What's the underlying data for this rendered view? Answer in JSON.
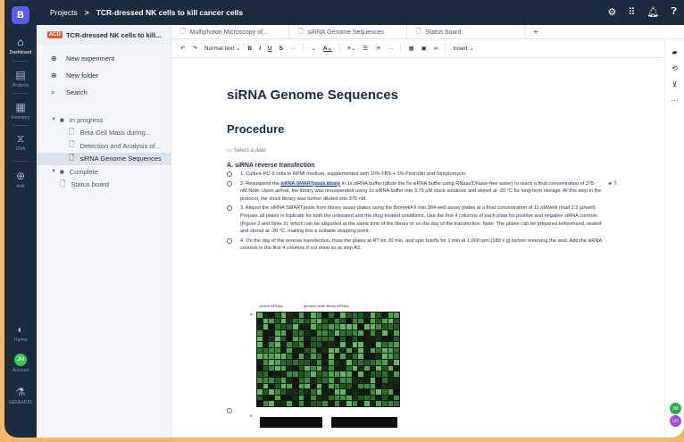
{
  "app": {
    "logo": "B"
  },
  "nav_rail": {
    "items": [
      {
        "label": "Dashboard",
        "icon": "home-icon"
      },
      {
        "label": "Projects",
        "icon": "clipboard-icon"
      },
      {
        "label": "Inventory",
        "icon": "box-icon"
      },
      {
        "label": "DNA",
        "icon": "dna-icon"
      },
      {
        "label": "Add",
        "icon": "plus-circle-icon"
      }
    ],
    "bottom": [
      {
        "label": "Theme",
        "icon": "half-circle-icon"
      },
      {
        "label": "Account",
        "avatar": "JM"
      },
      {
        "label": "GENEMOD",
        "icon": "flask-icon"
      }
    ]
  },
  "topbar": {
    "crumb1": "Projects",
    "separator": ">",
    "crumb2": "TCR-dressed NK cells to kill cancer cells",
    "tools": [
      "gear-icon",
      "grid-icon",
      "bell-icon",
      "help-icon"
    ]
  },
  "sidebar": {
    "tag": "ACD",
    "title": "TCR-dressed NK cells to kill...",
    "actions": [
      {
        "label": "New experiment",
        "icon": "plus-icon"
      },
      {
        "label": "New folder",
        "icon": "plus-icon"
      },
      {
        "label": "Search",
        "icon": "search-icon"
      }
    ],
    "tree": [
      {
        "label": "In progress",
        "type": "folder"
      },
      {
        "label": "Beta Cell Mass during...",
        "type": "doc"
      },
      {
        "label": "Detection and Analysis of...",
        "type": "doc"
      },
      {
        "label": "siRNA Genome Sequences",
        "type": "doc",
        "selected": true
      },
      {
        "label": "Complete",
        "type": "folder"
      },
      {
        "label": "Status board",
        "type": "doc"
      }
    ]
  },
  "tabs": [
    {
      "label": "Multiphoton Microscopy of..."
    },
    {
      "label": "siRNA Genome Sequences"
    },
    {
      "label": "Status board"
    }
  ],
  "toolbar": {
    "undo": "↶",
    "redo": "↷",
    "text_style": "Normal text ⌄",
    "bold": "B",
    "italic": "I",
    "underline": "U",
    "strike": "S",
    "more": "···",
    "highlight": "⌄",
    "color": "A⌄",
    "align": "≡⌄",
    "list": "☰",
    "numbered": "⁝≡",
    "more2": "···",
    "insert": "Insert ⌄"
  },
  "doc": {
    "title": "siRNA Genome Sequences",
    "heading": "Procedure",
    "date_placeholder": "Select a date",
    "section": "A. siRNA reverse transfection",
    "steps": {
      "s1": "1. Culture PC-9 cells in RPMI medium, supplemented with 10% FBS + 1% Penicillin and Streptomycin.",
      "s2_pre": "2. Resuspend the ",
      "s2_hl": "siRNA SMARTpools library",
      "s2_post": " in 1x siRNA buffer (dilute the 5x siRNA buffer using RNase/DNase-free water) to reach a final concentration of 375 nM.Note: Upon arrival, the library was resuspended using 1x siRNA buffer into 3.75 µM stock solutions and stored at -20 °C for long-term storage. At this step in the protocol, the stock library was further diluted into 375 nM.",
      "s3": "3. Aliquot the siRNA SMARTpools from library assay plates using the BiomekFX into 384-well assay plates at a final concentration of 11 nM/well (load 2.5 µl/well). Prepare all plates in triplicate for both the untreated and the drug-treated conditions. Use the first 4 columns of each plate for positive and negative siRNA controls (Figure 2 and Note 2), which can be aliquoted at the same time of the library or on the day of the transfection. Note: The plates can be prepared beforehand, sealed and stored at -20 °C, making this a suitable stopping point.",
      "s4": "4. On the day of the reverse transfection, thaw the plates at RT for 20 min, and spin briefly for 1 min at 1,000 rpm (180 x g) before removing the seal. Add the siRNA controls in the first 4 columns if not done so at step A3."
    },
    "comment_count": "3",
    "figure": {
      "label_a": "A",
      "controls": "control siRNAs",
      "library": "genome-wide library siRNAs",
      "label_b": "B"
    }
  },
  "right_rail": [
    "comment-icon",
    "history-icon",
    "pin-icon",
    "more-icon"
  ],
  "avatars": [
    {
      "initials": "JM",
      "color": "#34a853"
    },
    {
      "initials": "LH",
      "color": "#9c4fd6"
    }
  ]
}
